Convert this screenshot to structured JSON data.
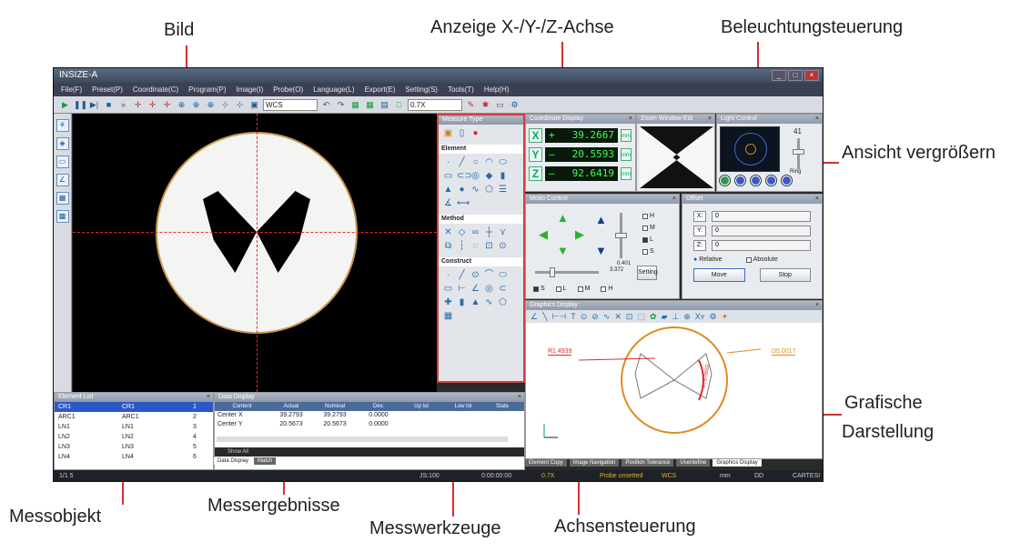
{
  "callouts": {
    "bild": "Bild",
    "achsen_anzeige": "Anzeige X-/Y-/Z-Achse",
    "beleuchtung": "Beleuchtungsteuerung",
    "ansicht": "Ansicht vergrößern",
    "grafische1": "Grafische",
    "grafische2": "Darstellung",
    "messobjekt": "Messobjekt",
    "messergebnisse": "Messergebnisse",
    "messwerkzeuge": "Messwerkzeuge",
    "achsensteuerung": "Achsensteuerung",
    "line_color": "#d03030"
  },
  "app": {
    "title": "INSIZE-A",
    "menu": [
      "File(F)",
      "Preset(P)",
      "Coordinate(C)",
      "Program(P)",
      "Image(I)",
      "Probe(O)",
      "Language(L)",
      "Export(E)",
      "Setting(S)",
      "Tools(T)",
      "Help(H)"
    ],
    "coord_system": "WCS",
    "zoom": "0.7X"
  },
  "measure_tools": {
    "title": "Measure Type",
    "element_label": "Element",
    "method_label": "Method",
    "construct_label": "Construct"
  },
  "coordinate_display": {
    "title": "Coordinate Display",
    "rows": [
      {
        "axis": "X",
        "sign": "+",
        "value": "39.2667",
        "unit": "mm"
      },
      {
        "axis": "Y",
        "sign": "–",
        "value": "20.5593",
        "unit": "mm"
      },
      {
        "axis": "Z",
        "sign": "–",
        "value": "92.6419",
        "unit": "mm"
      }
    ]
  },
  "zoom_window": {
    "title": "Zoom Window-Edi"
  },
  "light_control": {
    "title": "Light Control",
    "level": "41",
    "mode": "Ring"
  },
  "motion_control": {
    "title": "Motio Control",
    "speed": "0.401",
    "step": "3.372",
    "setting_label": "Setting",
    "axis_checks": [
      "H",
      "M",
      "L",
      "S"
    ],
    "bottom_checks": [
      "S",
      "L",
      "M",
      "H"
    ]
  },
  "offset": {
    "title": "Offset",
    "rows": [
      {
        "label": "X:",
        "value": "0"
      },
      {
        "label": "Y:",
        "value": "0"
      },
      {
        "label": "Z:",
        "value": "0"
      }
    ],
    "relative_label": "Relative",
    "absolute_label": "Absolute",
    "move_label": "Move",
    "stop_label": "Stop"
  },
  "graphics": {
    "title": "Graphics Display",
    "radius_label": "R1.4939",
    "circle_label": "D5.0017",
    "angle_label": "A79.0660"
  },
  "element_list": {
    "title": "Element List",
    "rows": [
      {
        "name": "CR1",
        "ref": "CR1",
        "idx": "1"
      },
      {
        "name": "ARC1",
        "ref": "ARC1",
        "idx": "2"
      },
      {
        "name": "LN1",
        "ref": "LN1",
        "idx": "3"
      },
      {
        "name": "LN2",
        "ref": "LN2",
        "idx": "4"
      },
      {
        "name": "LN3",
        "ref": "LN3",
        "idx": "5"
      },
      {
        "name": "LN4",
        "ref": "LN4",
        "idx": "6"
      }
    ]
  },
  "data_display": {
    "title": "Data Display",
    "headers": [
      "Content",
      "Actual",
      "Nominal",
      "Dev.",
      "Up tol",
      "Low tol",
      "State"
    ],
    "rows": [
      {
        "content": "Center X",
        "actual": "39.2793",
        "nominal": "39.2793",
        "dev": "0.0000"
      },
      {
        "content": "Center Y",
        "actual": "20.5673",
        "nominal": "20.5673",
        "dev": "0.0000"
      }
    ],
    "show_all": "Show All"
  },
  "bottom_tabs": [
    "Data Display",
    "Match"
  ],
  "right_tabs": [
    "Element Copy",
    "Image Navigation",
    "Position Tolerance",
    "Userdefine",
    "Graphics Display"
  ],
  "statusbar": {
    "page": "1/1 5",
    "js": "JS:100",
    "time": "0:00:00:00",
    "zoom": "0.7X",
    "probe": "Probe unsetted",
    "coord": "WCS",
    "unit": "mm",
    "angle": "DD",
    "mode": "CARTESI"
  }
}
